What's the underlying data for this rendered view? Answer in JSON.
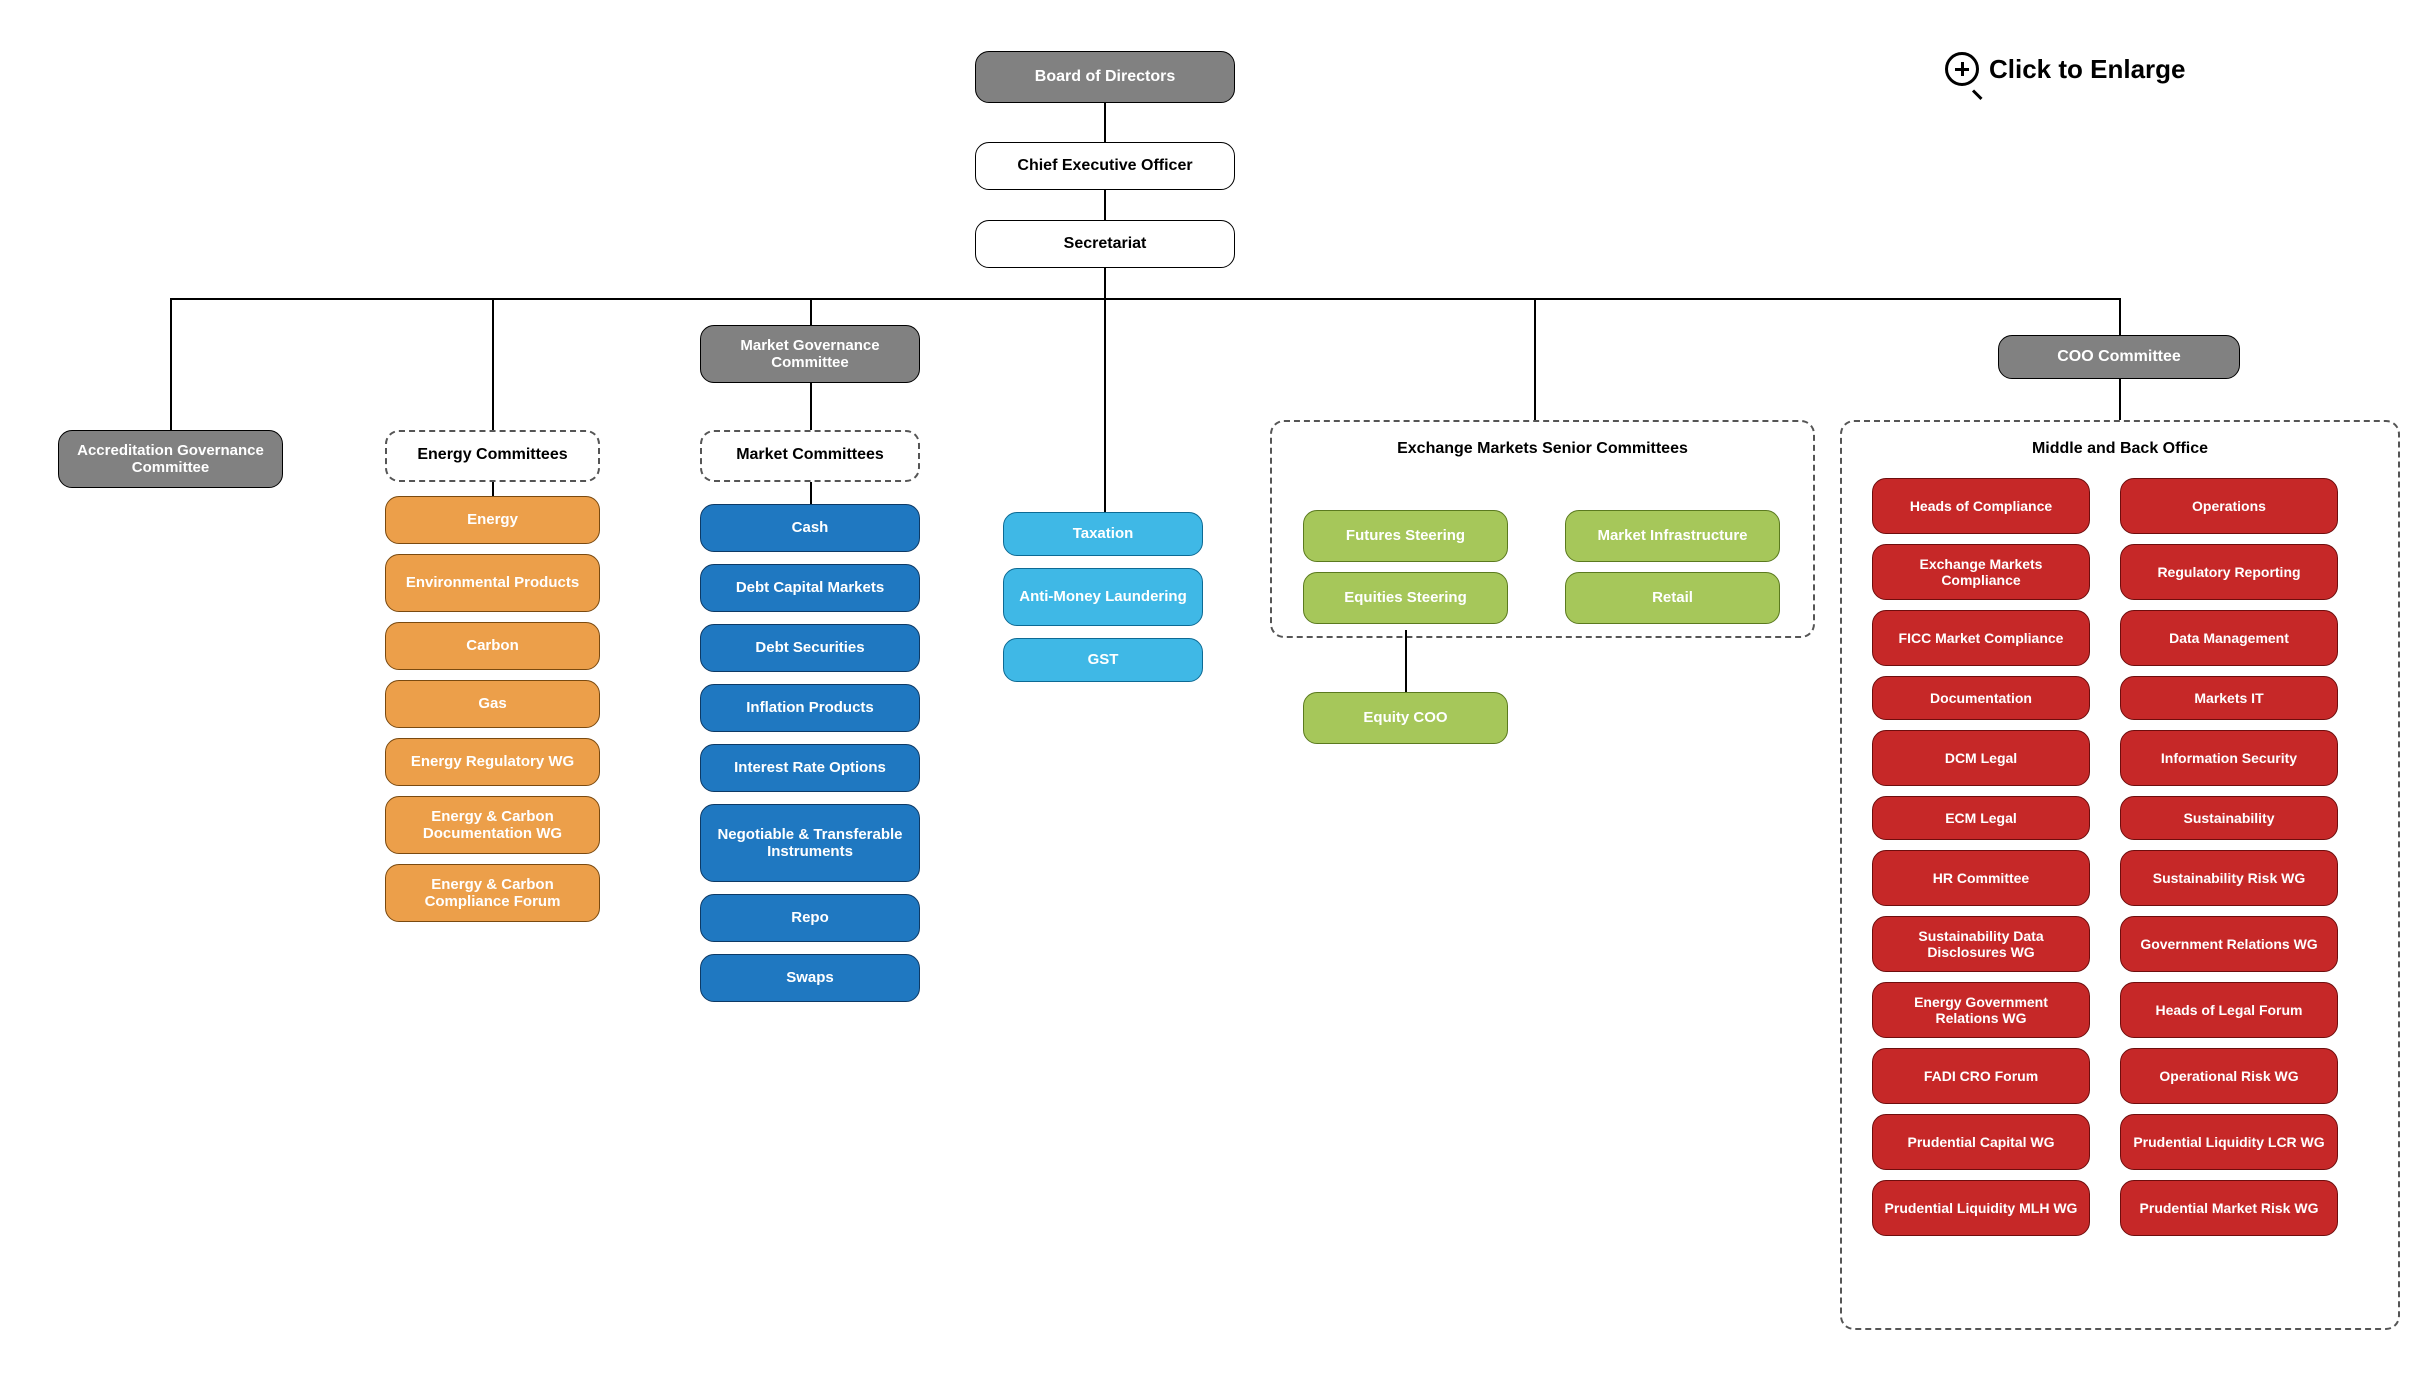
{
  "enlarge_label": "Click to Enlarge",
  "top": {
    "board": "Board of Directors",
    "ceo": "Chief Executive Officer",
    "secretariat": "Secretariat"
  },
  "accreditation": "Accreditation Governance Committee",
  "mgc": "Market Governance Committee",
  "coo_committee": "COO Committee",
  "groups": {
    "energy": "Energy Committees",
    "market": "Market Committees",
    "exchange": "Exchange Markets Senior Committees",
    "middle_back": "Middle and Back Office"
  },
  "energy_items": [
    "Energy",
    "Environmental Products",
    "Carbon",
    "Gas",
    "Energy Regulatory WG",
    "Energy & Carbon Documentation WG",
    "Energy & Carbon Compliance Forum"
  ],
  "market_items": [
    "Cash",
    "Debt Capital Markets",
    "Debt Securities",
    "Inflation Products",
    "Interest Rate Options",
    "Negotiable & Transferable Instruments",
    "Repo",
    "Swaps"
  ],
  "tax_items": [
    "Taxation",
    "Anti-Money Laundering",
    "GST"
  ],
  "exchange_items_left": [
    "Futures Steering",
    "Equities Steering"
  ],
  "exchange_items_right": [
    "Market Infrastructure",
    "Retail"
  ],
  "equity_coo": "Equity COO",
  "mbo_left": [
    "Heads of Compliance",
    "Exchange Markets Compliance",
    "FICC Market Compliance",
    "Documentation",
    "DCM Legal",
    "ECM Legal",
    "HR Committee",
    "Sustainability Data Disclosures WG",
    "Energy Government Relations WG",
    "FADI CRO Forum",
    "Prudential Capital WG",
    "Prudential Liquidity MLH WG"
  ],
  "mbo_right": [
    "Operations",
    "Regulatory Reporting",
    "Data Management",
    "Markets IT",
    "Information Security",
    "Sustainability",
    "Sustainability Risk WG",
    "Government Relations WG",
    "Heads of Legal Forum",
    "Operational Risk WG",
    "Prudential Liquidity LCR WG",
    "Prudential Market Risk WG"
  ],
  "colors": {
    "grey": "#818181",
    "orange": "#ec9f4a",
    "blue": "#1f78c1",
    "sky": "#3fb8e6",
    "green": "#a6c75a",
    "red": "#c62828"
  }
}
